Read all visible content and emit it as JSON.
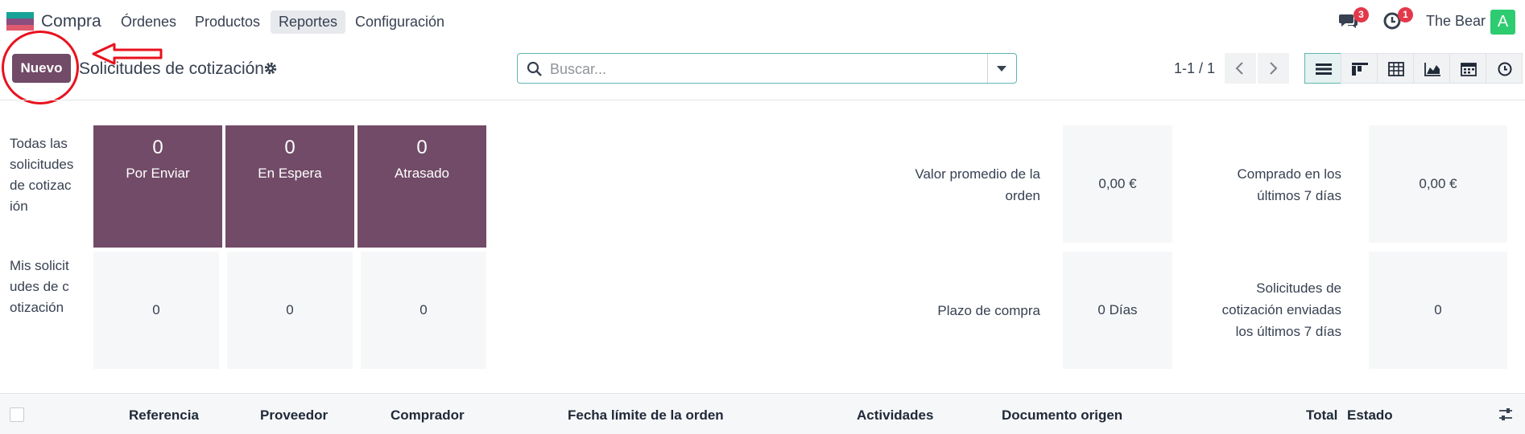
{
  "nav": {
    "app_name": "Compra",
    "menus": [
      "Órdenes",
      "Productos",
      "Reportes",
      "Configuración"
    ],
    "active_menu": "Reportes",
    "messages_badge": "3",
    "activities_badge": "1",
    "user_name": "The Bear",
    "avatar_letter": "A"
  },
  "control": {
    "new_button": "Nuevo",
    "title": "Solicitudes de cotización",
    "search_placeholder": "Buscar...",
    "pager": "1-1 / 1"
  },
  "views": [
    "list-icon",
    "kanban-icon",
    "pivot-icon",
    "graph-icon",
    "calendar-icon",
    "activity-icon"
  ],
  "dashboard": {
    "row_all": "Todas las solicitudes de cotización",
    "row_mine": "Mis solicitudes de cotización",
    "tiles": [
      {
        "count": "0",
        "label": "Por Enviar"
      },
      {
        "count": "0",
        "label": "En Espera"
      },
      {
        "count": "0",
        "label": "Atrasado"
      }
    ],
    "mine_values": [
      "0",
      "0",
      "0"
    ],
    "kpis": {
      "avg_order_label": "Valor promedio de la orden",
      "avg_order_value": "0,00 €",
      "bought_label": "Comprado en los últimos 7 días",
      "bought_value": "0,00 €",
      "lead_time_label": "Plazo de compra",
      "lead_time_value": "0 Días",
      "rfq_sent_label": "Solicitudes de cotización enviadas los últimos 7 días",
      "rfq_sent_value": "0"
    }
  },
  "table": {
    "columns": [
      "Referencia",
      "Proveedor",
      "Comprador",
      "Fecha límite de la orden",
      "Actividades",
      "Documento origen",
      "Total",
      "Estado"
    ]
  },
  "colors": {
    "primary": "#714b67",
    "accent": "#5fb4ae",
    "badge": "#e3384a",
    "annotation": "#e8121e"
  }
}
